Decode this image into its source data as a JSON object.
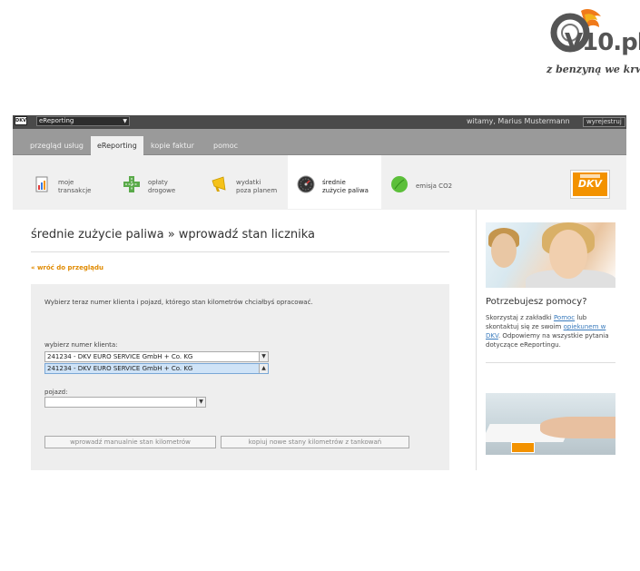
{
  "logo": {
    "brand": "V10.pl",
    "slogan": "z benzyną we krwi"
  },
  "topbar": {
    "app_select": "eReporting",
    "brand_mini": "DKV",
    "welcome": "witamy, Marius Mustermann",
    "logout": "wyrejestruj"
  },
  "nav": {
    "tabs": [
      {
        "label": "przegląd usług"
      },
      {
        "label": "eReporting"
      },
      {
        "label": "kopie faktur"
      },
      {
        "label": "pomoc"
      }
    ]
  },
  "subnav": {
    "items": [
      {
        "label1": "moje",
        "label2": "transakcje"
      },
      {
        "label1": "opłaty",
        "label2": "drogowe"
      },
      {
        "label1": "wydatki",
        "label2": "poza planem"
      },
      {
        "label1": "średnie",
        "label2": "zużycie paliwa"
      },
      {
        "label1": "emisja CO2",
        "label2": ""
      }
    ],
    "brand": "DKV"
  },
  "main": {
    "breadcrumb_section": "średnie zużycie paliwa",
    "breadcrumb_sep": " » ",
    "breadcrumb_page": "wprowadź stan licznika",
    "back_link": "« wróć do przeglądu",
    "intro": "Wybierz teraz numer klienta i pojazd, którego stan kilometrów chciałbyś opracować.",
    "client_label": "wybierz numer klienta:",
    "client_value": "241234 - DKV EURO SERVICE GmbH + Co. KG",
    "client_option_highlight": "241234 - DKV EURO SERVICE GmbH + Co. KG",
    "vehicle_label": "pojazd:",
    "vehicle_value": "",
    "btn_manual": "wprowadź manualnie stan kilometrów",
    "btn_copy": "kopiuj nowe stany kilometrów z tankowań"
  },
  "sidebar": {
    "help_title": "Potrzebujesz pomocy?",
    "help_text_1": "Skorzystaj z zakładki ",
    "help_link_1": "Pomoc",
    "help_text_2": " lub skontaktuj się ze swoim ",
    "help_link_2": "opiekunem w DKV",
    "help_text_3": ". Odpowiemy na wszystkie pytania dotyczące eReportingu."
  }
}
